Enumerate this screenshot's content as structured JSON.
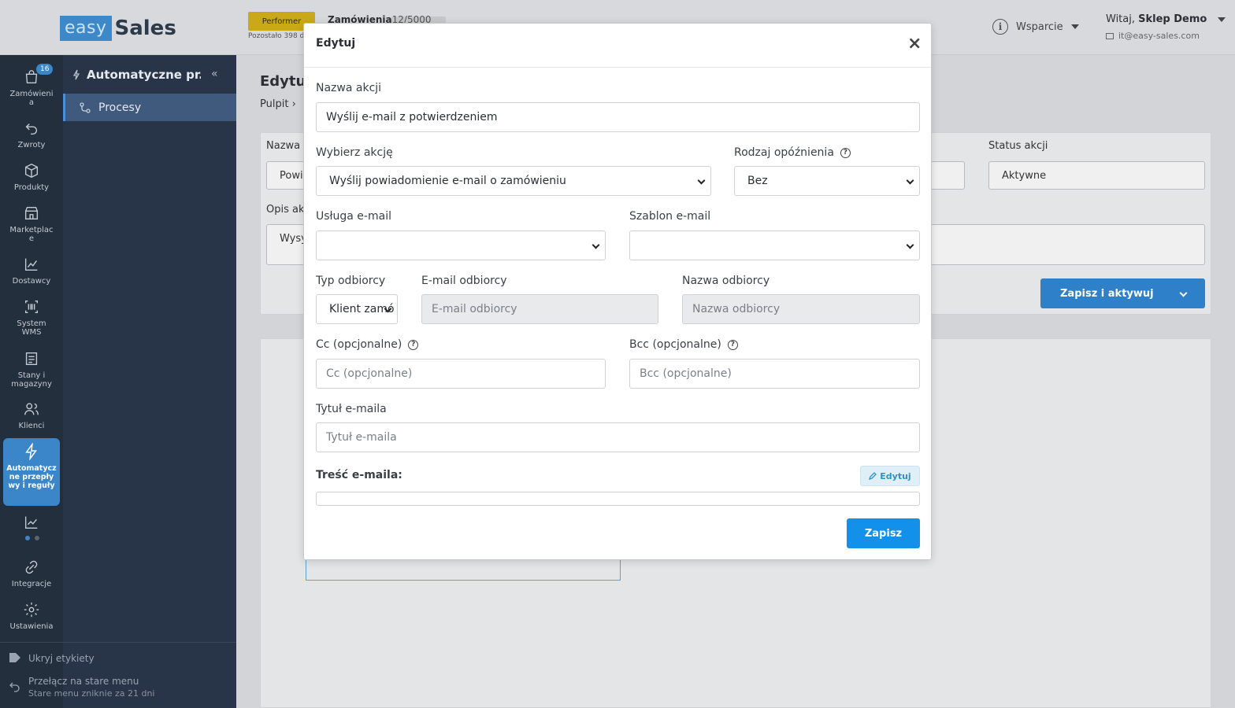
{
  "header": {
    "logo_easy": "easy",
    "logo_sales": "Sales",
    "plan_badge": "Performer",
    "orders_label": "Zamówienia",
    "orders_count": "12/5000",
    "remaining_text": "Pozostało 398 d",
    "support_label": "Wsparcie",
    "greeting": "Witaj, ",
    "user_name": "Sklep Demo",
    "user_email": "it@easy-sales.com"
  },
  "sidebar": {
    "items": [
      {
        "label": "Zamówienia",
        "icon": "shopping-bag-icon",
        "badge": "16"
      },
      {
        "label": "Zwroty",
        "icon": "return-arrow-icon"
      },
      {
        "label": "Produkty",
        "icon": "box-icon"
      },
      {
        "label": "Marketplace",
        "icon": "store-icon"
      },
      {
        "label": "Dostawcy",
        "icon": "chart-box-icon"
      },
      {
        "label": "System WMS",
        "icon": "barcode-icon"
      },
      {
        "label": "Stany i magazyny",
        "icon": "list-icon"
      },
      {
        "label": "Klienci",
        "icon": "users-icon"
      },
      {
        "label": "Automatyczne przepływy i reguły",
        "icon": "bolt-icon",
        "active": true
      },
      {
        "label": "",
        "icon": "line-chart-icon"
      },
      {
        "label": "Integracje",
        "icon": "link-icon"
      },
      {
        "label": "Ustawienia",
        "icon": "gear-icon"
      }
    ]
  },
  "subpanel": {
    "title": "Automatyczne pr...",
    "active_item": "Procesy",
    "hide_labels": "Ukryj etykiety",
    "switch_menu": "Przełącz na stare menu",
    "switch_menu_note": "Stare menu zniknie za 21 dni"
  },
  "background": {
    "page_title": "Edytuj",
    "breadcrumb_root": "Pulpit",
    "name_label": "Nazwa",
    "name_value": "Powi",
    "desc_label": "Opis ak",
    "desc_value": "Wysy",
    "status_label": "Status akcji",
    "status_value": "Aktywne",
    "save_activate": "Zapisz i aktywuj"
  },
  "modal": {
    "title": "Edytuj",
    "close_glyph": "×",
    "action_name_label": "Nazwa akcji",
    "action_name_value": "Wyślij e-mail z potwierdzeniem",
    "choose_action_label": "Wybierz akcję",
    "choose_action_value": "Wyślij powiadomienie e-mail o zamówieniu",
    "delay_type_label": "Rodzaj opóźnienia",
    "delay_type_value": "Bez",
    "email_service_label": "Usługa e-mail",
    "email_service_value": "",
    "email_template_label": "Szablon e-mail",
    "email_template_value": "",
    "recipient_type_label": "Typ odbiorcy",
    "recipient_type_value": "Klient zamó",
    "recipient_email_label": "E-mail odbiorcy",
    "recipient_email_placeholder": "E-mail odbiorcy",
    "recipient_name_label": "Nazwa odbiorcy",
    "recipient_name_placeholder": "Nazwa odbiorcy",
    "cc_label": "Cc (opcjonalne)",
    "cc_placeholder": "Cc (opcjonalne)",
    "bcc_label": "Bcc (opcjonalne)",
    "bcc_placeholder": "Bcc (opcjonalne)",
    "subject_label": "Tytuł e-maila",
    "subject_placeholder": "Tytuł e-maila",
    "body_label": "Treść e-maila:",
    "edit_button": "Edytuj",
    "save_button": "Zapisz"
  },
  "colors": {
    "primary": "#1390ea",
    "sidebar_bg": "#242f3e",
    "active_nav": "#3a86c8"
  }
}
